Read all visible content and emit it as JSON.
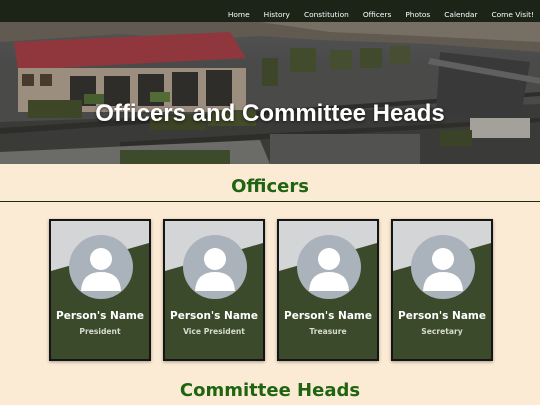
{
  "nav": {
    "items": [
      {
        "label": "Home"
      },
      {
        "label": "History"
      },
      {
        "label": "Constitution"
      },
      {
        "label": "Officers"
      },
      {
        "label": "Photos"
      },
      {
        "label": "Calendar"
      },
      {
        "label": "Come Visit!"
      }
    ]
  },
  "hero": {
    "title": "Officers and Committee Heads"
  },
  "officers": {
    "heading": "Officers",
    "cards": [
      {
        "name": "Person's Name",
        "role": "President"
      },
      {
        "name": "Person's Name",
        "role": "Vice President"
      },
      {
        "name": "Person's Name",
        "role": "Treasure"
      },
      {
        "name": "Person's Name",
        "role": "Secretary"
      }
    ]
  },
  "committee": {
    "heading": "Committee Heads"
  },
  "colors": {
    "nav_background": "#1c2417",
    "page_background": "#fbebd4",
    "heading_green": "#1f6410",
    "card_dark": "#3a4a2a"
  }
}
